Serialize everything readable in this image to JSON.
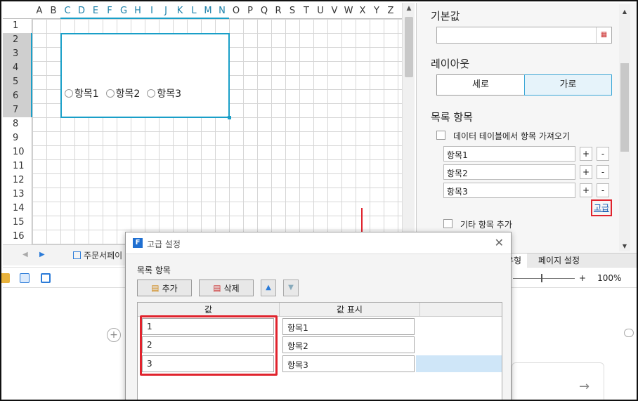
{
  "sheet": {
    "columns": [
      "A",
      "B",
      "C",
      "D",
      "E",
      "F",
      "G",
      "H",
      "I",
      "J",
      "K",
      "L",
      "M",
      "N",
      "O",
      "P",
      "Q",
      "R",
      "S",
      "T",
      "U",
      "V",
      "W",
      "X",
      "Y",
      "Z"
    ],
    "rows": [
      "1",
      "2",
      "3",
      "4",
      "5",
      "6",
      "7",
      "8",
      "9",
      "10",
      "11",
      "12",
      "13",
      "14",
      "15",
      "16"
    ],
    "radio_options": [
      "항목1",
      "항목2",
      "항목3"
    ],
    "tab_label": "주문서페이"
  },
  "panel": {
    "default_label": "기본값",
    "layout_label": "레이아웃",
    "layout_vertical": "세로",
    "layout_horizontal": "가로",
    "list_label": "목록 항목",
    "import_label": "데이터 테이블에서 항목 가져오기",
    "items": [
      "항목1",
      "항목2",
      "항목3"
    ],
    "plus": "+",
    "minus": "-",
    "advanced": "고급",
    "other_label": "기타 항목 추가",
    "tab_type": "유형",
    "tab_page": "페이지 설정",
    "zoom": "100%"
  },
  "dialog": {
    "title": "고급 설정",
    "section": "목록 항목",
    "add": "추가",
    "delete": "삭제",
    "col_value": "값",
    "col_display": "값 표시",
    "rows": [
      {
        "value": "1",
        "display": "항목1"
      },
      {
        "value": "2",
        "display": "항목2"
      },
      {
        "value": "3",
        "display": "항목3"
      }
    ]
  },
  "colors": {
    "accent": "#1a9fc8",
    "highlight": "#e0232d"
  }
}
